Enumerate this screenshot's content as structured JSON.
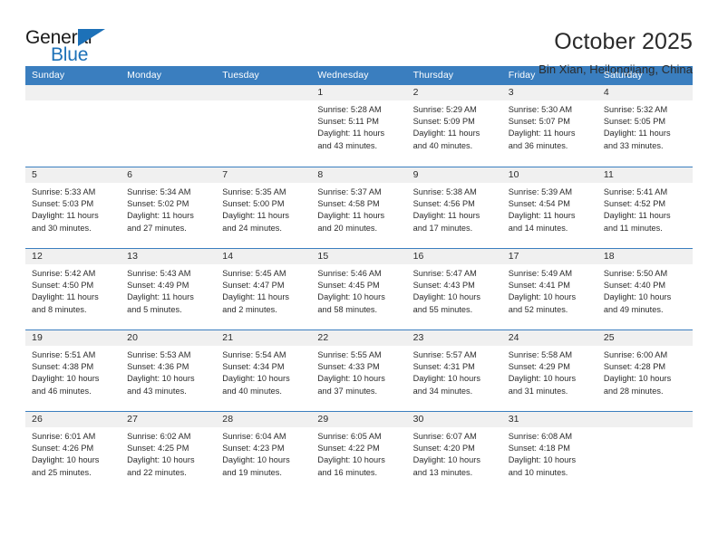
{
  "logo": {
    "word1": "General",
    "word2": "Blue",
    "triangle_color": "#1d71b8",
    "icon": "triangle-icon"
  },
  "header": {
    "title": "October 2025",
    "subtitle": "Bin Xian, Heilongjiang, China"
  },
  "theme": {
    "header_blue": "#3a7ebf",
    "day_band_gray": "#f0f0f0",
    "text": "#2b2b2b"
  },
  "weekdays": [
    "Sunday",
    "Monday",
    "Tuesday",
    "Wednesday",
    "Thursday",
    "Friday",
    "Saturday"
  ],
  "weeks": [
    [
      {
        "num": "",
        "lines": []
      },
      {
        "num": "",
        "lines": []
      },
      {
        "num": "",
        "lines": []
      },
      {
        "num": "1",
        "lines": [
          "Sunrise: 5:28 AM",
          "Sunset: 5:11 PM",
          "Daylight: 11 hours",
          "and 43 minutes."
        ]
      },
      {
        "num": "2",
        "lines": [
          "Sunrise: 5:29 AM",
          "Sunset: 5:09 PM",
          "Daylight: 11 hours",
          "and 40 minutes."
        ]
      },
      {
        "num": "3",
        "lines": [
          "Sunrise: 5:30 AM",
          "Sunset: 5:07 PM",
          "Daylight: 11 hours",
          "and 36 minutes."
        ]
      },
      {
        "num": "4",
        "lines": [
          "Sunrise: 5:32 AM",
          "Sunset: 5:05 PM",
          "Daylight: 11 hours",
          "and 33 minutes."
        ]
      }
    ],
    [
      {
        "num": "5",
        "lines": [
          "Sunrise: 5:33 AM",
          "Sunset: 5:03 PM",
          "Daylight: 11 hours",
          "and 30 minutes."
        ]
      },
      {
        "num": "6",
        "lines": [
          "Sunrise: 5:34 AM",
          "Sunset: 5:02 PM",
          "Daylight: 11 hours",
          "and 27 minutes."
        ]
      },
      {
        "num": "7",
        "lines": [
          "Sunrise: 5:35 AM",
          "Sunset: 5:00 PM",
          "Daylight: 11 hours",
          "and 24 minutes."
        ]
      },
      {
        "num": "8",
        "lines": [
          "Sunrise: 5:37 AM",
          "Sunset: 4:58 PM",
          "Daylight: 11 hours",
          "and 20 minutes."
        ]
      },
      {
        "num": "9",
        "lines": [
          "Sunrise: 5:38 AM",
          "Sunset: 4:56 PM",
          "Daylight: 11 hours",
          "and 17 minutes."
        ]
      },
      {
        "num": "10",
        "lines": [
          "Sunrise: 5:39 AM",
          "Sunset: 4:54 PM",
          "Daylight: 11 hours",
          "and 14 minutes."
        ]
      },
      {
        "num": "11",
        "lines": [
          "Sunrise: 5:41 AM",
          "Sunset: 4:52 PM",
          "Daylight: 11 hours",
          "and 11 minutes."
        ]
      }
    ],
    [
      {
        "num": "12",
        "lines": [
          "Sunrise: 5:42 AM",
          "Sunset: 4:50 PM",
          "Daylight: 11 hours",
          "and 8 minutes."
        ]
      },
      {
        "num": "13",
        "lines": [
          "Sunrise: 5:43 AM",
          "Sunset: 4:49 PM",
          "Daylight: 11 hours",
          "and 5 minutes."
        ]
      },
      {
        "num": "14",
        "lines": [
          "Sunrise: 5:45 AM",
          "Sunset: 4:47 PM",
          "Daylight: 11 hours",
          "and 2 minutes."
        ]
      },
      {
        "num": "15",
        "lines": [
          "Sunrise: 5:46 AM",
          "Sunset: 4:45 PM",
          "Daylight: 10 hours",
          "and 58 minutes."
        ]
      },
      {
        "num": "16",
        "lines": [
          "Sunrise: 5:47 AM",
          "Sunset: 4:43 PM",
          "Daylight: 10 hours",
          "and 55 minutes."
        ]
      },
      {
        "num": "17",
        "lines": [
          "Sunrise: 5:49 AM",
          "Sunset: 4:41 PM",
          "Daylight: 10 hours",
          "and 52 minutes."
        ]
      },
      {
        "num": "18",
        "lines": [
          "Sunrise: 5:50 AM",
          "Sunset: 4:40 PM",
          "Daylight: 10 hours",
          "and 49 minutes."
        ]
      }
    ],
    [
      {
        "num": "19",
        "lines": [
          "Sunrise: 5:51 AM",
          "Sunset: 4:38 PM",
          "Daylight: 10 hours",
          "and 46 minutes."
        ]
      },
      {
        "num": "20",
        "lines": [
          "Sunrise: 5:53 AM",
          "Sunset: 4:36 PM",
          "Daylight: 10 hours",
          "and 43 minutes."
        ]
      },
      {
        "num": "21",
        "lines": [
          "Sunrise: 5:54 AM",
          "Sunset: 4:34 PM",
          "Daylight: 10 hours",
          "and 40 minutes."
        ]
      },
      {
        "num": "22",
        "lines": [
          "Sunrise: 5:55 AM",
          "Sunset: 4:33 PM",
          "Daylight: 10 hours",
          "and 37 minutes."
        ]
      },
      {
        "num": "23",
        "lines": [
          "Sunrise: 5:57 AM",
          "Sunset: 4:31 PM",
          "Daylight: 10 hours",
          "and 34 minutes."
        ]
      },
      {
        "num": "24",
        "lines": [
          "Sunrise: 5:58 AM",
          "Sunset: 4:29 PM",
          "Daylight: 10 hours",
          "and 31 minutes."
        ]
      },
      {
        "num": "25",
        "lines": [
          "Sunrise: 6:00 AM",
          "Sunset: 4:28 PM",
          "Daylight: 10 hours",
          "and 28 minutes."
        ]
      }
    ],
    [
      {
        "num": "26",
        "lines": [
          "Sunrise: 6:01 AM",
          "Sunset: 4:26 PM",
          "Daylight: 10 hours",
          "and 25 minutes."
        ]
      },
      {
        "num": "27",
        "lines": [
          "Sunrise: 6:02 AM",
          "Sunset: 4:25 PM",
          "Daylight: 10 hours",
          "and 22 minutes."
        ]
      },
      {
        "num": "28",
        "lines": [
          "Sunrise: 6:04 AM",
          "Sunset: 4:23 PM",
          "Daylight: 10 hours",
          "and 19 minutes."
        ]
      },
      {
        "num": "29",
        "lines": [
          "Sunrise: 6:05 AM",
          "Sunset: 4:22 PM",
          "Daylight: 10 hours",
          "and 16 minutes."
        ]
      },
      {
        "num": "30",
        "lines": [
          "Sunrise: 6:07 AM",
          "Sunset: 4:20 PM",
          "Daylight: 10 hours",
          "and 13 minutes."
        ]
      },
      {
        "num": "31",
        "lines": [
          "Sunrise: 6:08 AM",
          "Sunset: 4:18 PM",
          "Daylight: 10 hours",
          "and 10 minutes."
        ]
      },
      {
        "num": "",
        "lines": []
      }
    ]
  ]
}
